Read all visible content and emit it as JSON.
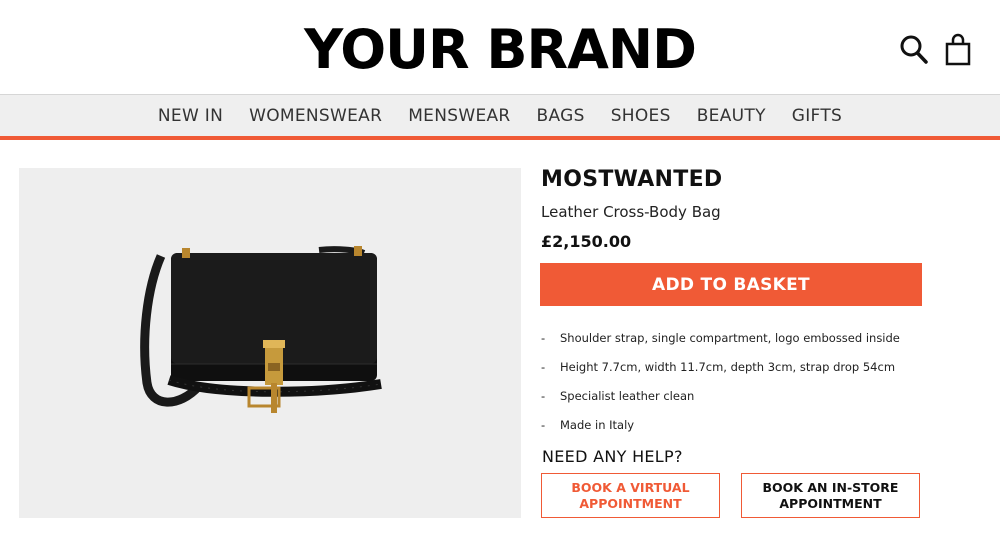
{
  "header": {
    "logo": "YOUR BRAND",
    "icons": [
      "search-icon",
      "shopping-bag-icon"
    ]
  },
  "nav": {
    "items": [
      "NEW IN",
      "WOMENSWEAR",
      "MENSWEAR",
      "BAGS",
      "SHOES",
      "BEAUTY",
      "GIFTS"
    ]
  },
  "product": {
    "brand": "MOSTWANTED",
    "name": "Leather Cross-Body Bag",
    "price": "£2,150.00",
    "add_to_basket": "ADD TO BASKET",
    "features": [
      "Shoulder strap, single compartment, logo embossed inside",
      "Height 7.7cm, width 11.7cm, depth 3cm, strap drop 54cm",
      "Specialist leather clean",
      "Made in Italy"
    ],
    "bullet": "-"
  },
  "help": {
    "title": "NEED ANY HELP?",
    "virtual_button": "BOOK A VIRTUAL APPOINTMENT",
    "store_button": "BOOK AN IN-STORE APPOINTMENT"
  },
  "colors": {
    "accent": "#f05a36",
    "nav_bg": "#efefef",
    "image_bg": "#eeeeee"
  }
}
